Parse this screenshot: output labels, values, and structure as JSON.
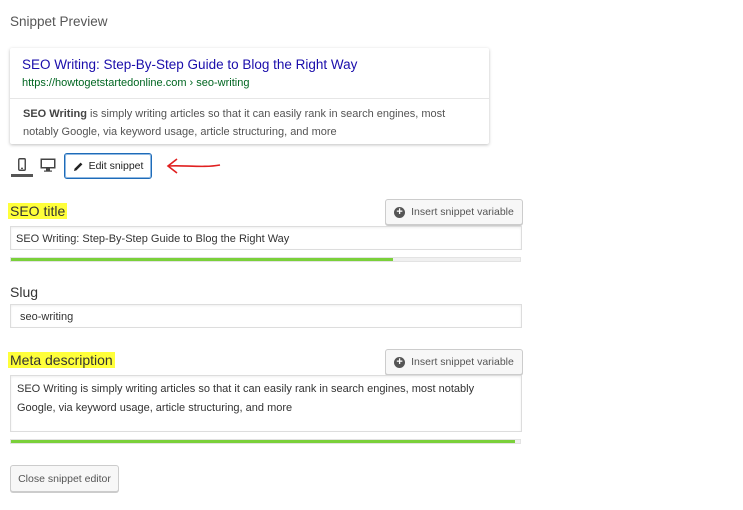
{
  "heading": "Snippet Preview",
  "preview": {
    "title": "SEO Writing: Step-By-Step Guide to Blog the Right Way",
    "url": "https://howtogetstartedonline.com › seo-writing",
    "description_bold": "SEO Writing",
    "description_rest": " is simply writing articles so that it can easily rank in search engines, most notably Google, via keyword usage, article structuring, and more"
  },
  "toolbar": {
    "mobile_icon": "mobile-icon",
    "desktop_icon": "desktop-icon",
    "edit_label": "Edit snippet"
  },
  "seo_title": {
    "label": "SEO title",
    "insert_label": "Insert snippet variable",
    "value": "SEO Writing: Step-By-Step Guide to Blog the Right Way",
    "progress": 0.75
  },
  "slug": {
    "label": "Slug",
    "value": "seo-writing"
  },
  "meta_description": {
    "label": "Meta description",
    "insert_label": "Insert snippet variable",
    "value": "SEO Writing is simply writing articles so that it can easily rank in search engines, most notably Google, via keyword usage, article structuring, and more",
    "progress": 0.99
  },
  "close_label": "Close snippet editor",
  "colors": {
    "highlight": "#ffff3a",
    "progress_good": "#7ad03a",
    "link_title": "#1a0dab",
    "url": "#006621",
    "annotation_arrow": "#e02020"
  }
}
